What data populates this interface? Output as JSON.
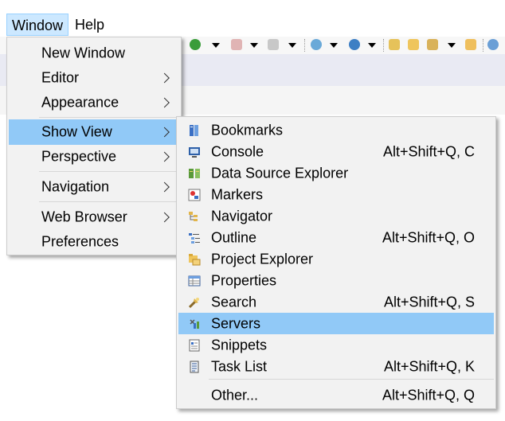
{
  "menubar": {
    "items": [
      {
        "label": "Window"
      },
      {
        "label": "Help"
      }
    ]
  },
  "window_menu": {
    "items": [
      {
        "label": "New Window"
      },
      {
        "label": "Editor"
      },
      {
        "label": "Appearance"
      },
      {
        "label": "Show View"
      },
      {
        "label": "Perspective"
      },
      {
        "label": "Navigation"
      },
      {
        "label": "Web Browser"
      },
      {
        "label": "Preferences"
      }
    ]
  },
  "show_view_menu": {
    "items": [
      {
        "label": "Bookmarks",
        "shortcut": "",
        "icon": "bookmarks-icon"
      },
      {
        "label": "Console",
        "shortcut": "Alt+Shift+Q, C",
        "icon": "console-icon"
      },
      {
        "label": "Data Source Explorer",
        "shortcut": "",
        "icon": "data-source-explorer-icon"
      },
      {
        "label": "Markers",
        "shortcut": "",
        "icon": "markers-icon"
      },
      {
        "label": "Navigator",
        "shortcut": "",
        "icon": "navigator-icon"
      },
      {
        "label": "Outline",
        "shortcut": "Alt+Shift+Q, O",
        "icon": "outline-icon"
      },
      {
        "label": "Project Explorer",
        "shortcut": "",
        "icon": "project-explorer-icon"
      },
      {
        "label": "Properties",
        "shortcut": "",
        "icon": "properties-icon"
      },
      {
        "label": "Search",
        "shortcut": "Alt+Shift+Q, S",
        "icon": "search-icon"
      },
      {
        "label": "Servers",
        "shortcut": "",
        "icon": "servers-icon"
      },
      {
        "label": "Snippets",
        "shortcut": "",
        "icon": "snippets-icon"
      },
      {
        "label": "Task List",
        "shortcut": "Alt+Shift+Q, K",
        "icon": "task-list-icon"
      },
      {
        "label": "Other...",
        "shortcut": "Alt+Shift+Q, Q"
      }
    ]
  },
  "colors": {
    "highlight": "#91c9f7",
    "menubar_active": "#cce8ff",
    "menu_bg": "#f2f2f2"
  }
}
